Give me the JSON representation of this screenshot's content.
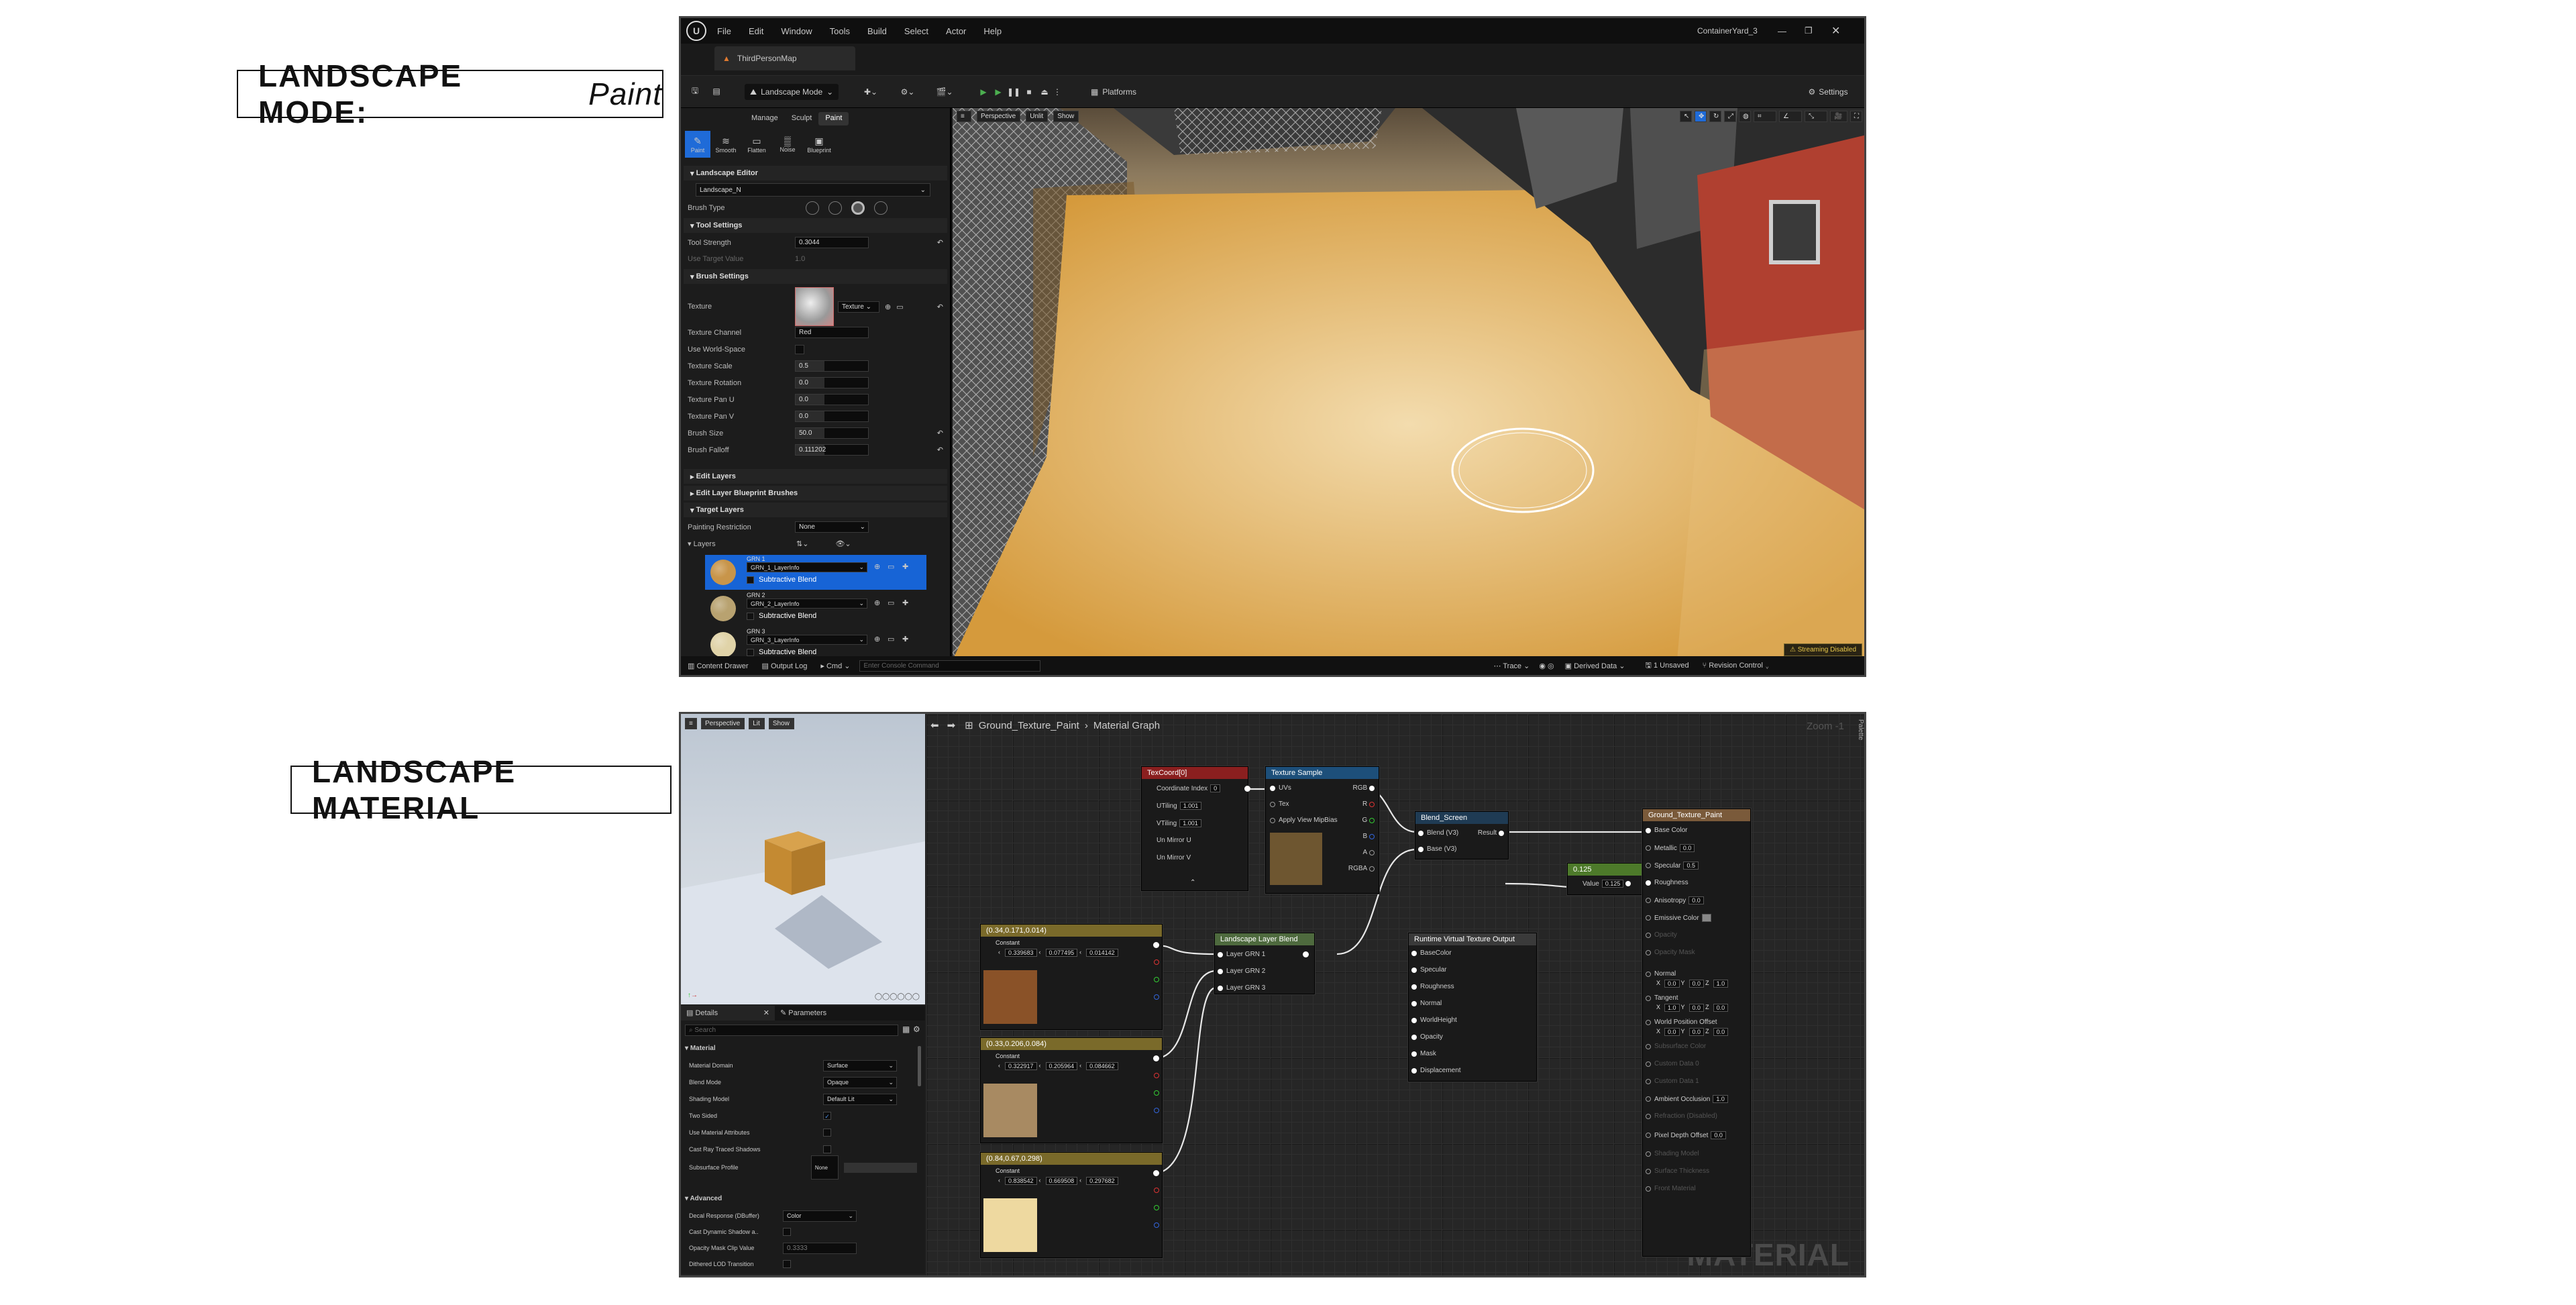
{
  "headings": {
    "paint_title": "LANDSCAPE MODE:",
    "paint_sub": "Paint",
    "material_title": "LANDSCAPE MATERIAL"
  },
  "editor": {
    "menu": [
      "File",
      "Edit",
      "Window",
      "Tools",
      "Build",
      "Select",
      "Actor",
      "Help"
    ],
    "project": "ContainerYard_3",
    "map_tab": "ThirdPersonMap",
    "mode_dropdown": "Landscape Mode",
    "platforms": "Platforms",
    "settings": "Settings",
    "mode_tabs": [
      "Manage",
      "Sculpt",
      "Paint"
    ],
    "tools": [
      "Paint",
      "Smooth",
      "Flatten",
      "Noise",
      "Blueprint"
    ],
    "sections": {
      "landscape_editor": "Landscape Editor",
      "tool_settings": "Tool Settings",
      "brush_settings": "Brush Settings",
      "edit_layers": "Edit Layers",
      "edit_layer_blueprint": "Edit Layer Blueprint Brushes",
      "target_layers": "Target Layers"
    },
    "landscape_name": "Landscape_N",
    "brush_type_label": "Brush Type",
    "tool_strength": {
      "label": "Tool Strength",
      "value": "0.3044"
    },
    "use_target": {
      "label": "Use Target Value",
      "value": "1.0"
    },
    "texture_label": "Texture",
    "texture_btn": "Texture",
    "props": [
      {
        "label": "Texture Channel",
        "value": "Red"
      },
      {
        "label": "Use World-Space",
        "value": ""
      },
      {
        "label": "Texture Scale",
        "value": "0.5"
      },
      {
        "label": "Texture Rotation",
        "value": "0.0"
      },
      {
        "label": "Texture Pan U",
        "value": "0.0"
      },
      {
        "label": "Texture Pan V",
        "value": "0.0"
      },
      {
        "label": "Brush Size",
        "value": "50.0"
      },
      {
        "label": "Brush Falloff",
        "value": "0.111202"
      }
    ],
    "painting_restriction": {
      "label": "Painting Restriction",
      "value": "None"
    },
    "layers_label": "Layers",
    "layers": [
      {
        "name": "GRN 1",
        "info": "GRN_1_LayerInfo",
        "blend": "Subtractive Blend",
        "color": "#c8954a"
      },
      {
        "name": "GRN 2",
        "info": "GRN_2_LayerInfo",
        "blend": "Subtractive Blend",
        "color": "#b8a270"
      },
      {
        "name": "GRN 3",
        "info": "GRN_3_LayerInfo",
        "blend": "Subtractive Blend",
        "color": "#e0d3a8"
      }
    ],
    "viewport_buttons": [
      "Perspective",
      "Unlit",
      "Show"
    ],
    "streaming": "Streaming Disabled",
    "status": {
      "content_drawer": "Content Drawer",
      "output_log": "Output Log",
      "cmd": "Cmd",
      "console": "Enter Console Command",
      "trace": "Trace",
      "derived": "Derived Data",
      "unsaved": "1 Unsaved",
      "revision": "Revision Control"
    }
  },
  "material": {
    "breadcrumb": {
      "asset": "Ground_Texture_Paint",
      "graph": "Material Graph"
    },
    "zoom": "Zoom -1",
    "palette": "Palette",
    "watermark": "MATERIAL",
    "preview_buttons": [
      "Perspective",
      "Lit",
      "Show"
    ],
    "tabs": {
      "details": "Details",
      "parameters": "Parameters"
    },
    "search_placeholder": "Search",
    "details_section": "Material",
    "details": [
      {
        "label": "Material Domain",
        "value": "Surface"
      },
      {
        "label": "Blend Mode",
        "value": "Opaque"
      },
      {
        "label": "Shading Model",
        "value": "Default Lit"
      },
      {
        "label": "Two Sided",
        "value": ""
      },
      {
        "label": "Use Material Attributes",
        "value": ""
      },
      {
        "label": "Cast Ray Traced Shadows",
        "value": ""
      },
      {
        "label": "Subsurface Profile",
        "value": "None"
      }
    ],
    "advanced": "Advanced",
    "advanced_rows": [
      {
        "label": "Decal Response (DBuffer)",
        "value": "Color"
      },
      {
        "label": "Cast Dynamic Shadow a..",
        "value": ""
      },
      {
        "label": "Opacity Mask Clip Value",
        "value": "0.3333"
      },
      {
        "label": "Dithered LOD Transition",
        "value": ""
      }
    ],
    "nodes": {
      "texcoord": {
        "title": "TexCoord[0]",
        "pins": [
          "Coordinate Index",
          "UTiling",
          "VTiling",
          "Un Mirror U",
          "Un Mirror V"
        ],
        "vals": [
          "0",
          "1.001",
          "1.001"
        ]
      },
      "texsample": {
        "title": "Texture Sample",
        "in": [
          "UVs",
          "Tex",
          "Apply View MipBias"
        ],
        "out": [
          "RGB",
          "R",
          "G",
          "B",
          "A",
          "RGBA"
        ]
      },
      "blend": {
        "title": "Blend_Screen",
        "in": [
          "Blend (V3)",
          "Base (V3)"
        ],
        "out": "Result"
      },
      "scalar": {
        "title": "0.125",
        "pin": "Value",
        "val": "0.125"
      },
      "result": {
        "title": "Ground_Texture_Paint",
        "pins": [
          "Base Color",
          "Metallic",
          "Specular",
          "Roughness",
          "Anisotropy",
          "Emissive Color",
          "Opacity",
          "Opacity Mask",
          "Normal",
          "Tangent",
          "World Position Offset",
          "Subsurface Color",
          "Custom Data 0",
          "Custom Data 1",
          "Ambient Occlusion",
          "Refraction (Disabled)",
          "Pixel Depth Offset",
          "Shading Model",
          "Surface Thickness",
          "Front Material"
        ],
        "metallic": "0.0",
        "specular": "0.5",
        "anisotropy": "0.0",
        "ao": "1.0",
        "pdo": "0.0",
        "normal": [
          "0.0",
          "0.0",
          "1.0"
        ],
        "tangent": [
          "1.0",
          "0.0",
          "0.0"
        ],
        "wpo": [
          "0.0",
          "0.0",
          "0.0"
        ]
      },
      "layerblend": {
        "title": "Landscape Layer Blend",
        "pins": [
          "Layer GRN 1",
          "Layer GRN 2",
          "Layer GRN 3"
        ]
      },
      "rvt": {
        "title": "Runtime Virtual Texture Output",
        "pins": [
          "BaseColor",
          "Specular",
          "Roughness",
          "Normal",
          "WorldHeight",
          "Opacity",
          "Mask",
          "Displacement"
        ]
      },
      "const1": {
        "title": "(0.34,0.171,0.014)",
        "label": "Constant",
        "vals": [
          "0.339683",
          "0.077495",
          "0.014142"
        ],
        "color": "#8a5228"
      },
      "const2": {
        "title": "(0.33,0.206,0.084)",
        "label": "Constant",
        "vals": [
          "0.322917",
          "0.205964",
          "0.084662"
        ],
        "color": "#a88a62"
      },
      "const3": {
        "title": "(0.84,0.67,0.298)",
        "label": "Constant",
        "vals": [
          "0.838542",
          "0.669508",
          "0.297682"
        ],
        "color": "#eed9a0"
      }
    }
  }
}
